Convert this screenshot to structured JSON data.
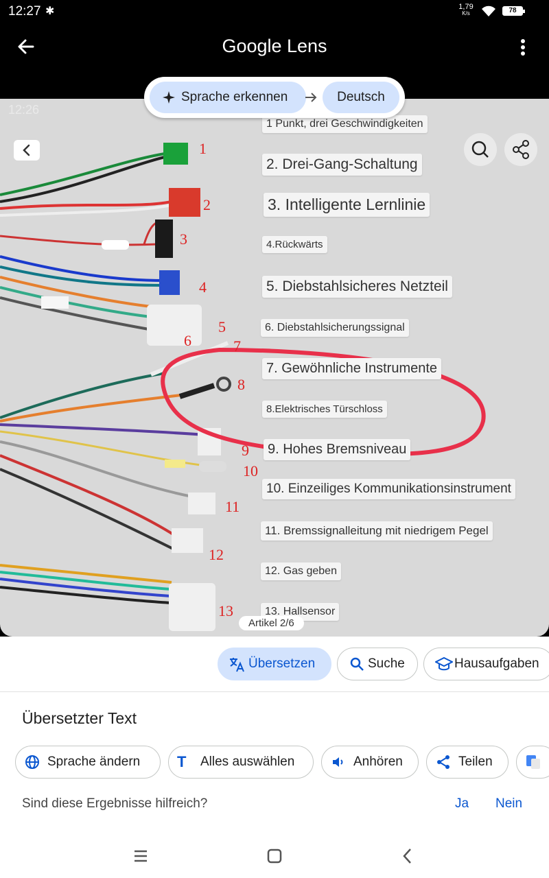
{
  "status_bar": {
    "time": "12:27",
    "speed": "1,79",
    "speed_unit": "K/s",
    "battery": "78"
  },
  "app_bar": {
    "title": "Google Lens"
  },
  "ghost_status_time": "12:26",
  "language": {
    "source_label": "Sprache erkennen",
    "target_label": "Deutsch"
  },
  "overlay": {
    "labels": [
      "1 Punkt, drei Geschwindigkeiten",
      "2. Drei-Gang-Schaltung",
      "3. Intelligente Lernlinie",
      "4.Rückwärts",
      "5. Diebstahlsicheres Netzteil",
      "6. Diebstahlsicherungssignal",
      "7. Gewöhnliche Instrumente",
      "8.Elektrisches Türschloss",
      "9. Hohes Bremsniveau",
      "10. Einzeiliges Kommunikationsinstrument",
      "11. Bremssignalleitung mit niedrigem Pegel",
      "12. Gas geben",
      "13. Hallsensor"
    ],
    "numbers": [
      "1",
      "2",
      "3",
      "4",
      "5",
      "6",
      "7",
      "8",
      "9",
      "10",
      "11",
      "12",
      "13"
    ],
    "artikel": "Artikel 2/6"
  },
  "chips": {
    "translate": "Übersetzen",
    "search": "Suche",
    "homework": "Hausaufgaben"
  },
  "sheet": {
    "title": "Übersetzter Text",
    "actions": {
      "change_language": "Sprache ändern",
      "select_all": "Alles auswählen",
      "listen": "Anhören",
      "share": "Teilen"
    },
    "helpful_question": "Sind diese Ergebnisse hilfreich?",
    "yes": "Ja",
    "no": "Nein"
  },
  "colors": {
    "accent": "#0b57d0",
    "chip_active_bg": "#d3e3fd",
    "annotation_red": "#e8304a"
  }
}
